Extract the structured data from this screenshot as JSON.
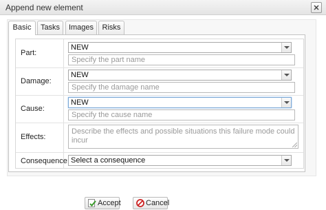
{
  "window": {
    "title": "Append new element"
  },
  "tabs": [
    {
      "label": "Basic",
      "active": true
    },
    {
      "label": "Tasks",
      "active": false
    },
    {
      "label": "Images",
      "active": false
    },
    {
      "label": "Risks",
      "active": false
    }
  ],
  "form": {
    "part": {
      "label": "Part:",
      "select_value": "NEW",
      "name_placeholder": "Specify the part name"
    },
    "damage": {
      "label": "Damage:",
      "select_value": "NEW",
      "name_placeholder": "Specify the damage name"
    },
    "cause": {
      "label": "Cause:",
      "select_value": "NEW",
      "name_placeholder": "Specify the cause name"
    },
    "effects": {
      "label": "Effects:",
      "placeholder": "Describe the effects and possible situations this failure mode could incur"
    },
    "consequence": {
      "label": "Consequence:",
      "select_value": "Select a consequence"
    }
  },
  "buttons": {
    "accept_label": "Accept",
    "cancel_label": "Cancel"
  },
  "colors": {
    "accept_icon": "#3a9a2a",
    "cancel_icon": "#cc2222",
    "focus_border": "#7aa7d6"
  }
}
